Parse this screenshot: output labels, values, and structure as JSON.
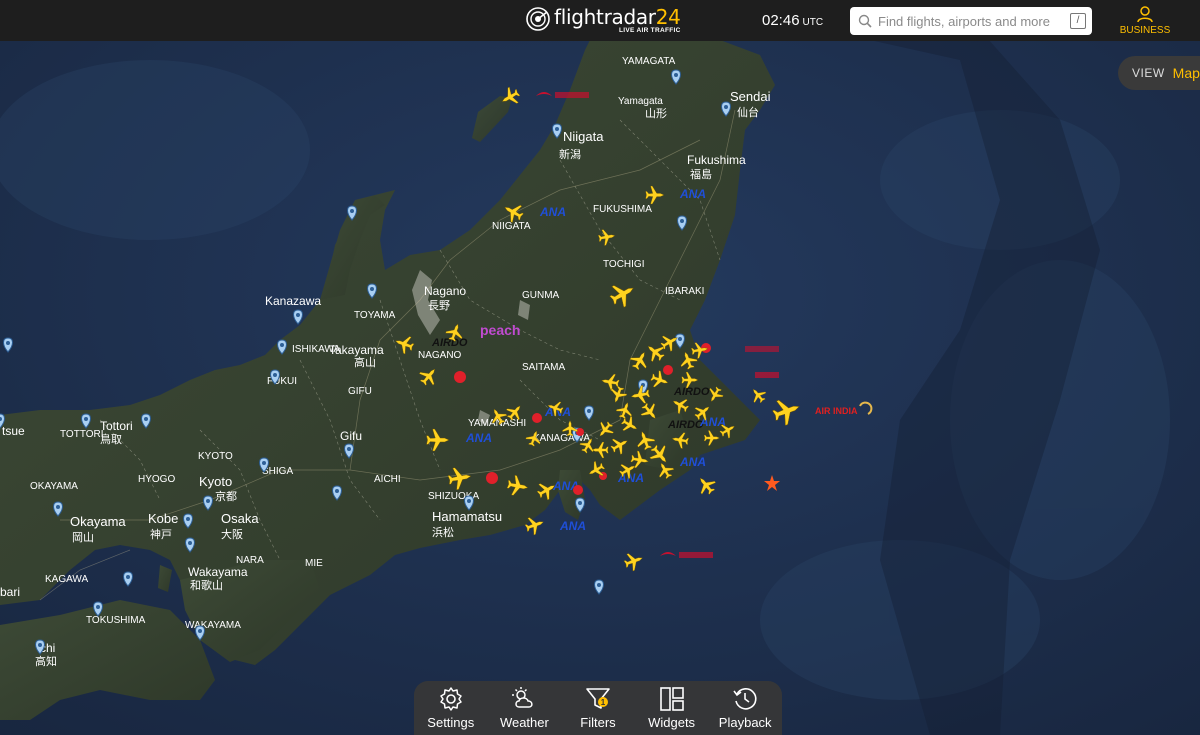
{
  "header": {
    "logo_text": "flightradar",
    "logo_number": "24",
    "logo_tagline": "LIVE AIR TRAFFIC",
    "time": "02:46",
    "time_zone": "UTC",
    "search_placeholder": "Find flights, airports and more",
    "search_shortcut": "/",
    "business_label": "BUSINESS"
  },
  "view_control": {
    "label": "VIEW",
    "value": "Map"
  },
  "bottom_bar": [
    {
      "label": "Settings",
      "icon": "gear-icon"
    },
    {
      "label": "Weather",
      "icon": "weather-icon"
    },
    {
      "label": "Filters",
      "icon": "filter-icon"
    },
    {
      "label": "Widgets",
      "icon": "widgets-icon"
    },
    {
      "label": "Playback",
      "icon": "playback-icon"
    }
  ],
  "map_labels": {
    "yamagata_pref": "YAMAGATA",
    "yamagata_city": "Yamagata",
    "yamagata_jp": "山形",
    "sendai": "Sendai",
    "sendai_jp": "仙台",
    "niigata_city": "Niigata",
    "niigata_jp": "新潟",
    "fukushima_city": "Fukushima",
    "fukushima_jp": "福島",
    "fukushima_pref": "FUKUSHIMA",
    "niigata_pref": "NIIGATA",
    "tochigi": "TOCHIGI",
    "ibaraki": "IBARAKI",
    "gunma": "GUNMA",
    "nagano_city": "Nagano",
    "nagano_jp": "長野",
    "nagano_pref": "NAGANO",
    "kanazawa": "Kanazawa",
    "toyama": "TOYAMA",
    "ishikawa": "ISHIKAWA",
    "takayama": "Takayama",
    "takayama_jp": "高山",
    "saitama": "SAITAMA",
    "fukui": "FUKUI",
    "gifu_pref": "GIFU",
    "yamanashi": "YAMANASHI",
    "kanagawa": "KANAGAWA",
    "tottori_pref": "TOTTORI",
    "tottori_city": "Tottori",
    "tottori_jp": "鳥取",
    "tsue": "tsue",
    "gifu_city": "Gifu",
    "kyoto_pref": "KYOTO",
    "kyoto_city": "Kyoto",
    "kyoto_jp": "京都",
    "shiga": "SHIGA",
    "hyogo": "HYOGO",
    "aichi": "AICHI",
    "okayama_pref": "OKAYAMA",
    "okayama_city": "Okayama",
    "okayama_jp": "岡山",
    "kobe": "Kobe",
    "kobe_jp": "神戸",
    "osaka": "Osaka",
    "osaka_jp": "大阪",
    "shizuoka": "SHIZUOKA",
    "hamamatsu": "Hamamatsu",
    "hamamatsu_jp": "浜松",
    "nara": "NARA",
    "mie": "MIE",
    "kagawa": "KAGAWA",
    "wakayama_city": "Wakayama",
    "wakayama_jp": "和歌山",
    "tokushima": "TOKUSHIMA",
    "wakayama_pref": "WAKAYAMA",
    "bari": "bari",
    "chi": "chi",
    "chi_jp": "高知"
  },
  "airline_labels": {
    "peach": "peach",
    "air_india": "AIR INDIA",
    "airdo": "AIRDO",
    "ana": "ANA"
  }
}
